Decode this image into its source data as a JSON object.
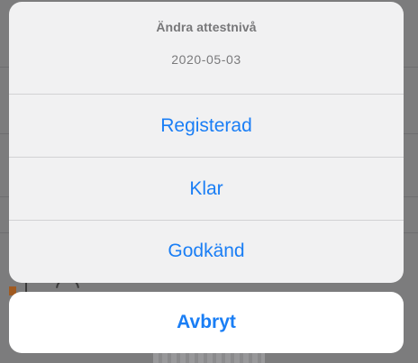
{
  "action_sheet": {
    "title": "Ändra attestnivå",
    "subtitle": "2020-05-03",
    "options": [
      {
        "label": "Registerad"
      },
      {
        "label": "Klar"
      },
      {
        "label": "Godkänd"
      }
    ],
    "cancel_label": "Avbryt"
  },
  "colors": {
    "accent": "#1a7ef5",
    "sheet_background": "#f1f1f2",
    "overlay": "#7f7f80"
  }
}
